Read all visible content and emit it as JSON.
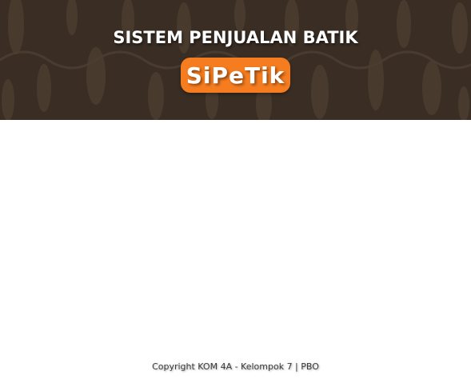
{
  "header": {
    "title": "SISTEM PENJUALAN BATIK",
    "brand": "SiPeTik",
    "background_color": "#3a2e24",
    "pattern_color": "#4a3c30",
    "brand_color": "#f57c1f"
  },
  "footer": {
    "copyright": "Copyright KOM 4A - Kelompok 7 | PBO"
  }
}
